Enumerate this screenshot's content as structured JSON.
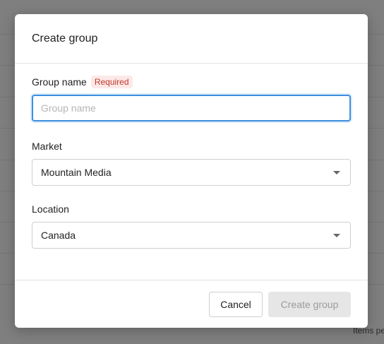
{
  "background": {
    "footer_text": "Items pe"
  },
  "modal": {
    "title": "Create group",
    "group_name": {
      "label": "Group name",
      "badge": "Required",
      "placeholder": "Group name",
      "value": ""
    },
    "market": {
      "label": "Market",
      "selected": "Mountain Media"
    },
    "location": {
      "label": "Location",
      "selected": "Canada"
    },
    "footer": {
      "cancel_label": "Cancel",
      "create_label": "Create group"
    }
  },
  "colors": {
    "focus_border": "#3d8fe0",
    "required_text": "#c0392b",
    "required_bg": "#fde8e8",
    "disabled_button_bg": "#e6e6e6"
  }
}
